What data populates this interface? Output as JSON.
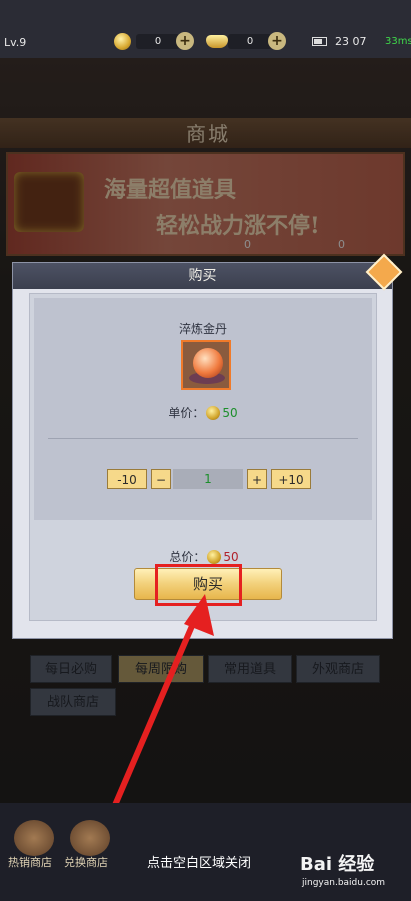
{
  "status": {
    "level": "Lv.9",
    "currency1_value": "0",
    "currency2_value": "0",
    "clock": "23 07",
    "ping": "33ms"
  },
  "shop": {
    "title": "商城",
    "banner_line1": "海量超值道具",
    "banner_line2": "轻松战力涨不停!",
    "banner_count1": "0",
    "banner_count2": "0"
  },
  "dialog": {
    "title": "购买",
    "item_name": "淬炼金丹",
    "unit_price_label": "单价：",
    "unit_price": "50",
    "minus10": "-10",
    "minus": "−",
    "quantity": "1",
    "plus": "+",
    "plus10": "+10",
    "total_label": "总价：",
    "total_price": "50",
    "buy_button": "购买"
  },
  "tabs": [
    {
      "label": "每日必购"
    },
    {
      "label": "每周限购"
    },
    {
      "label": "常用道具"
    },
    {
      "label": "外观商店"
    },
    {
      "label": "战队商店"
    }
  ],
  "bottom": {
    "hot_shop": "热销商店",
    "exchange_shop": "兑换商店",
    "close_hint": "点击空白区域关闭"
  },
  "watermark": {
    "brand": "Bai 经验",
    "url": "jingyan.baidu.com"
  },
  "colors": {
    "annotation": "#e52020",
    "price_green": "#1c8f2b",
    "price_red": "#b0222b"
  }
}
